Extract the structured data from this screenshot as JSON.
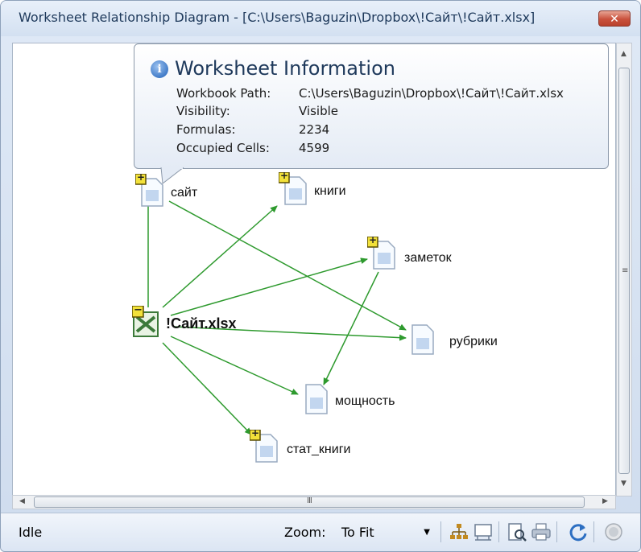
{
  "window": {
    "title": "Worksheet Relationship Diagram - [C:\\Users\\Baguzin\\Dropbox\\!Сайт\\!Сайт.xlsx]",
    "close_glyph": "✕"
  },
  "tooltip": {
    "title": "Worksheet Information",
    "rows": [
      {
        "key": "Workbook Path:",
        "value": "C:\\Users\\Baguzin\\Dropbox\\!Сайт\\!Сайт.xlsx"
      },
      {
        "key": "Visibility:",
        "value": "Visible"
      },
      {
        "key": "Formulas:",
        "value": "2234"
      },
      {
        "key": "Occupied Cells:",
        "value": "4599"
      }
    ]
  },
  "diagram": {
    "root": {
      "label": "!Сайт.xlsx",
      "expand_glyph": "−"
    },
    "sheets": [
      {
        "label": "сайт",
        "expand_glyph": "+"
      },
      {
        "label": "книги",
        "expand_glyph": "+"
      },
      {
        "label": "заметок",
        "expand_glyph": "+"
      },
      {
        "label": "рубрики",
        "expand_glyph": ""
      },
      {
        "label": "мощность",
        "expand_glyph": ""
      },
      {
        "label": "стат_книги",
        "expand_glyph": "+"
      }
    ],
    "edge_color": "#2e9a2e"
  },
  "status": {
    "text": "Idle",
    "zoom_label": "Zoom:",
    "zoom_value": "To Fit"
  },
  "toolbar_icons": [
    "hierarchy-layout-icon",
    "print-layout-icon",
    "print-preview-icon",
    "print-icon",
    "refresh-icon",
    "stop-icon"
  ]
}
